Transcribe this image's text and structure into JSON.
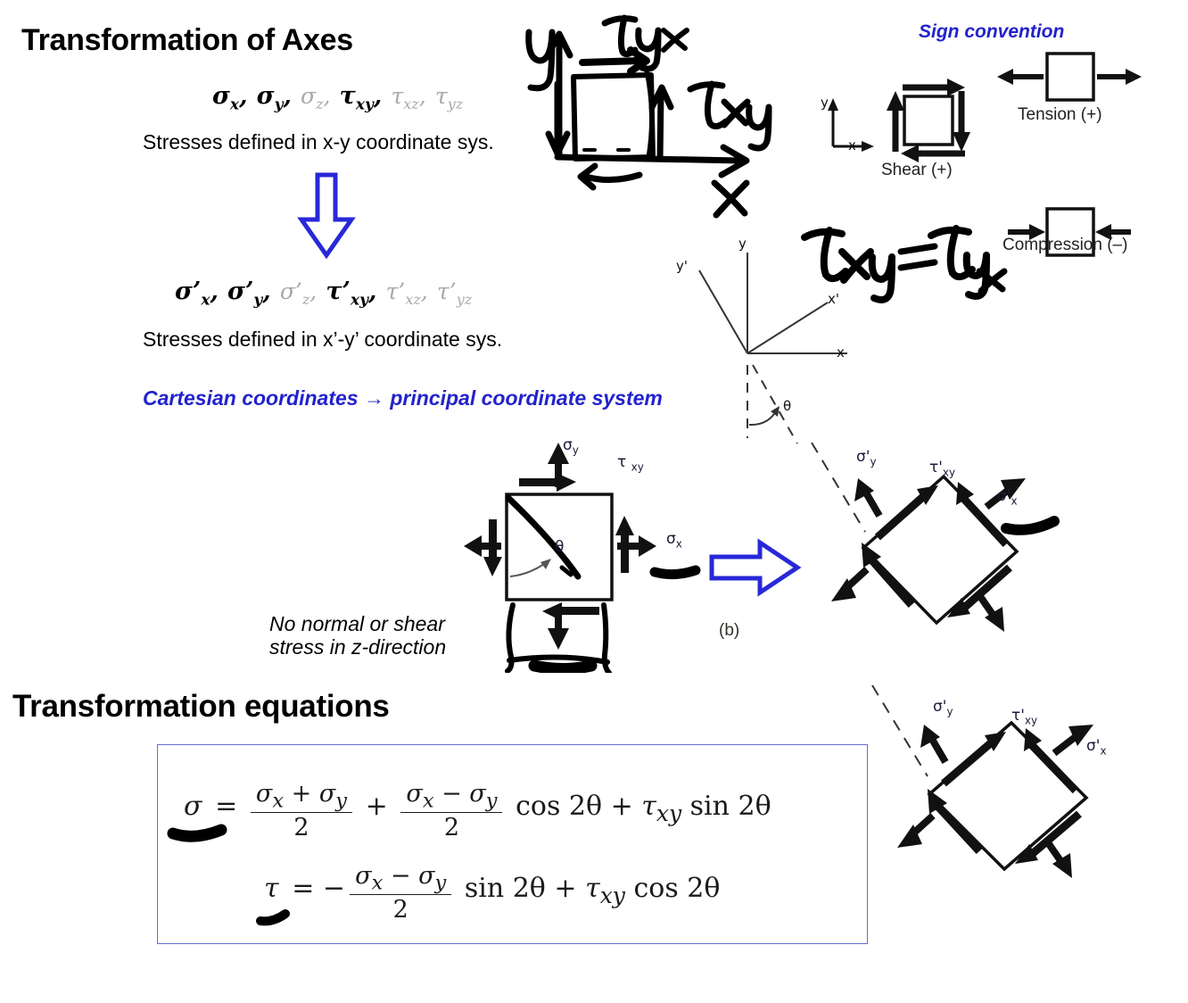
{
  "slide1": {
    "title": "Transformation of Axes",
    "stress_line_xy": {
      "black": [
        "σx,",
        "σy,",
        "τxy,"
      ],
      "gray": [
        "σz,",
        "τxz,",
        "τyz"
      ],
      "parts": [
        {
          "base": "σ",
          "sub": "x",
          "sep": ",",
          "gray": false
        },
        {
          "base": "σ",
          "sub": "y",
          "sep": ",",
          "gray": false
        },
        {
          "base": "σ",
          "sub": "z",
          "sep": ",",
          "gray": true
        },
        {
          "base": "τ",
          "sub": "xy",
          "sep": ",",
          "gray": false
        },
        {
          "base": "τ",
          "sub": "xz",
          "sep": ",",
          "gray": true
        },
        {
          "base": "τ",
          "sub": "yz",
          "sep": "",
          "gray": true
        }
      ]
    },
    "caption_xy": "Stresses defined in x-y coordinate sys.",
    "stress_line_xy_prime": {
      "parts": [
        {
          "base": "σ'",
          "sub": "x",
          "sep": ",",
          "gray": false
        },
        {
          "base": "σ'",
          "sub": "y",
          "sep": ",",
          "gray": false
        },
        {
          "base": "σ'",
          "sub": "z",
          "sep": ",",
          "gray": true
        },
        {
          "base": "τ'",
          "sub": "xy",
          "sep": ",",
          "gray": false
        },
        {
          "base": "τ'",
          "sub": "xz",
          "sep": ",",
          "gray": true
        },
        {
          "base": "τ'",
          "sub": "yz",
          "sep": "",
          "gray": true
        }
      ]
    },
    "caption_xy_prime": "Stresses defined in x’-y’ coordinate sys.",
    "cartesian_note": "Cartesian coordinates → principal coordinate system",
    "z_note_line1": "No normal or shear",
    "z_note_line2": "stress in z-direction",
    "figure_label_b": "(b)"
  },
  "sign_convention": {
    "heading": "Sign convention",
    "tension_label": "Tension (+)",
    "compression_label": "Compression (–)",
    "shear_label": "Shear (+)",
    "axis_y": "y",
    "axis_x": "x"
  },
  "handwriting": {
    "y_axis": "y",
    "x_axis": "x",
    "tau_yx": "τyx",
    "tau_xy": "τxy",
    "tau_equality": "τxy = τyx"
  },
  "axes_diagram": {
    "y": "y",
    "y_prime": "y'",
    "x": "x",
    "x_prime": "x'",
    "theta": "θ"
  },
  "element_unrotated": {
    "sigma_y": "σy",
    "sigma_x": "σx",
    "tau_xy": "τxy",
    "theta": "θ"
  },
  "element_rotated": {
    "sigma_y_prime": "σ'y",
    "sigma_x_prime": "σ'x",
    "tau_xy_prime": "τ'xy"
  },
  "slide2": {
    "title": "Transformation equations",
    "equation_sigma": {
      "lhs": "σ",
      "eq": "=",
      "term1_num": "σx + σy",
      "term1_den": "2",
      "plus1": "+",
      "term2_num": "σx − σy",
      "term2_den": "2",
      "cos": "cos 2θ",
      "plus2": "+",
      "tau": "τxy",
      "sin": "sin 2θ"
    },
    "equation_tau": {
      "lhs": "τ",
      "eq": "=",
      "minus": "−",
      "term_num": "σx − σy",
      "term_den": "2",
      "sin": "sin 2θ",
      "plus": "+",
      "tau": "τxy",
      "cos": "cos 2θ"
    }
  },
  "colors": {
    "blue_accent": "#2222cc",
    "blue_arrow": "#2828d8",
    "box_border": "#6a6ad8",
    "divider": "#b9bdc9",
    "gray_symbol": "#a9a9a9"
  }
}
